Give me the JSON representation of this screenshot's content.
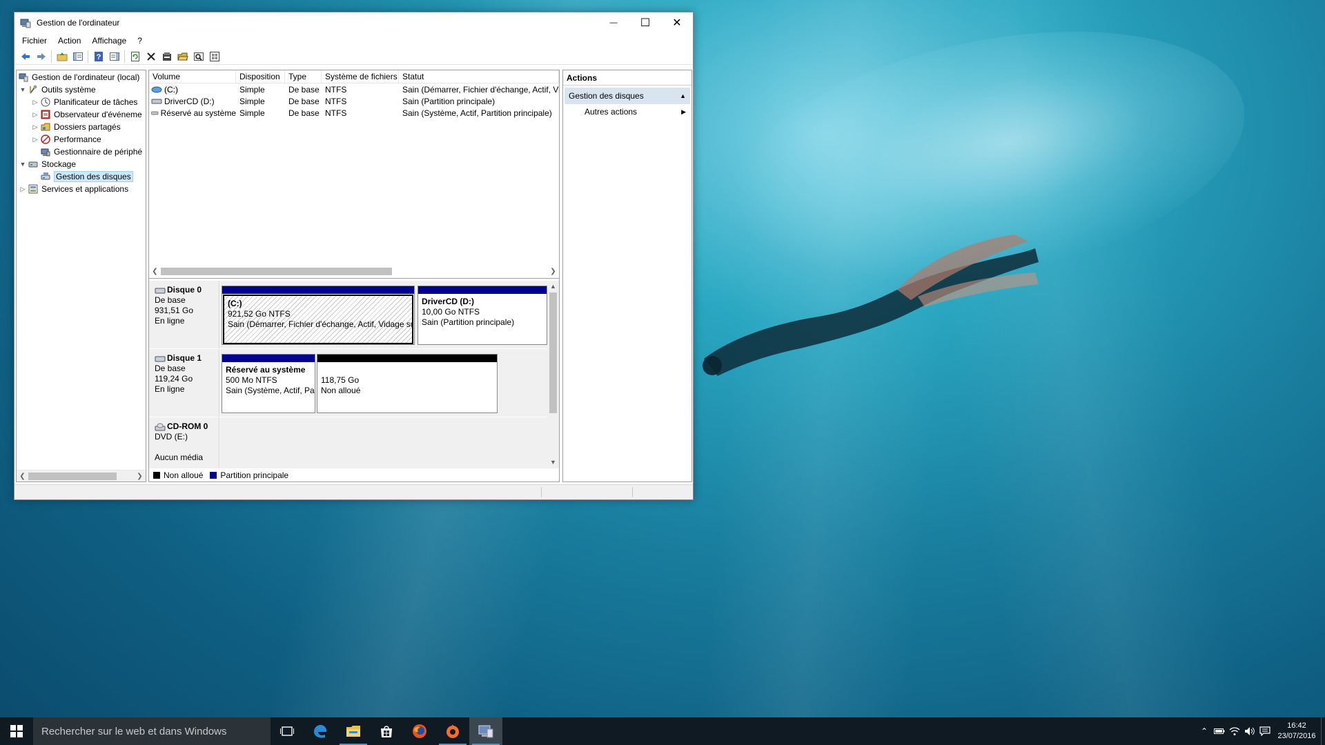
{
  "window": {
    "title": "Gestion de l'ordinateur",
    "controls": {
      "minimize": "—",
      "maximize": "☐",
      "close": "✕"
    }
  },
  "menu": [
    "Fichier",
    "Action",
    "Affichage",
    "?"
  ],
  "toolbar_icons": [
    "back-arrow-icon",
    "forward-arrow-icon",
    "up-folder-icon",
    "show-hide-tree-icon",
    "help-icon",
    "show-hide-action-pane-icon",
    "refresh-icon",
    "delete-icon",
    "properties-icon",
    "open-icon",
    "search-icon",
    "settings-icon"
  ],
  "tree": {
    "root": "Gestion de l'ordinateur (local)",
    "items": [
      {
        "label": "Outils système",
        "level": 1,
        "expanded": true
      },
      {
        "label": "Planificateur de tâches",
        "level": 2
      },
      {
        "label": "Observateur d'événeme",
        "level": 2
      },
      {
        "label": "Dossiers partagés",
        "level": 2
      },
      {
        "label": "Performance",
        "level": 2
      },
      {
        "label": "Gestionnaire de périphé",
        "level": 2
      },
      {
        "label": "Stockage",
        "level": 1,
        "expanded": true
      },
      {
        "label": "Gestion des disques",
        "level": 2,
        "selected": true
      },
      {
        "label": "Services et applications",
        "level": 1
      }
    ]
  },
  "volumes": {
    "headers": [
      "Volume",
      "Disposition",
      "Type",
      "Système de fichiers",
      "Statut"
    ],
    "rows": [
      [
        "(C:)",
        "Simple",
        "De base",
        "NTFS",
        "Sain (Démarrer, Fichier d'échange, Actif, Vi"
      ],
      [
        "DriverCD (D:)",
        "Simple",
        "De base",
        "NTFS",
        "Sain (Partition principale)"
      ],
      [
        "Réservé au système",
        "Simple",
        "De base",
        "NTFS",
        "Sain (Système, Actif, Partition principale)"
      ]
    ]
  },
  "disks": [
    {
      "name": "Disque 0",
      "kind": "De base",
      "size": "931,51 Go",
      "state": "En ligne",
      "partitions": [
        {
          "name": "(C:)",
          "size": "921,52 Go NTFS",
          "status": "Sain (Démarrer, Fichier d'échange, Actif, Vidage su"
        },
        {
          "name": "DriverCD  (D:)",
          "size": "10,00 Go NTFS",
          "status": "Sain (Partition principale)"
        }
      ]
    },
    {
      "name": "Disque 1",
      "kind": "De base",
      "size": "119,24 Go",
      "state": "En ligne",
      "partitions": [
        {
          "name": "Réservé au système",
          "size": "500 Mo NTFS",
          "status": "Sain (Système, Actif, Pa"
        },
        {
          "name": "",
          "size": "118,75 Go",
          "status": "Non alloué"
        }
      ]
    },
    {
      "name": "CD-ROM 0",
      "kind": "DVD (E:)",
      "size": "",
      "state": "Aucun média"
    }
  ],
  "legend": {
    "unallocated": "Non alloué",
    "primary": "Partition principale",
    "colors": {
      "unallocated": "#000000",
      "primary": "#000090"
    }
  },
  "actions": {
    "title": "Actions",
    "section": "Gestion des disques",
    "item": "Autres actions"
  },
  "taskbar": {
    "search_placeholder": "Rechercher sur le web et dans Windows",
    "apps": [
      "task-view-icon",
      "edge-icon",
      "file-explorer-icon",
      "store-icon",
      "firefox-icon",
      "origin-icon",
      "computer-management-icon"
    ],
    "time": "16:42",
    "date": "23/07/2016"
  }
}
